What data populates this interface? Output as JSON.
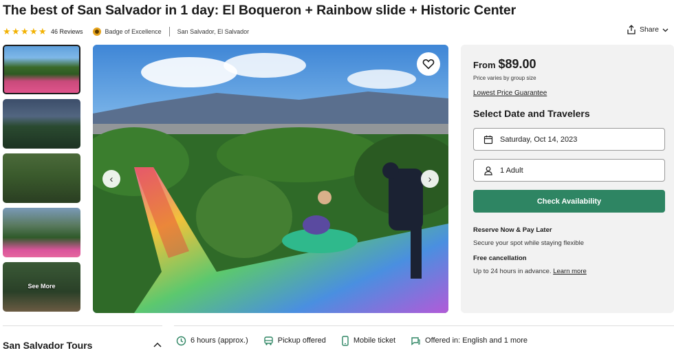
{
  "title": "The best of San Salvador in 1 day: El Boqueron + Rainbow slide + Historic Center",
  "meta": {
    "rating_stars": 5,
    "reviews": "46 Reviews",
    "badge": "Badge of Excellence",
    "location": "San Salvador, El Salvador",
    "share_label": "Share"
  },
  "gallery": {
    "see_more": "See More",
    "thumbnail_count": 5
  },
  "booking": {
    "from_label": "From",
    "price": "$89.00",
    "price_note": "Price varies by group size",
    "lowest_price": "Lowest Price Guarantee",
    "select_title": "Select Date and Travelers",
    "date_value": "Saturday, Oct 14, 2023",
    "travelers_value": "1 Adult",
    "check_button": "Check Availability",
    "reserve_title": "Reserve Now & Pay Later",
    "reserve_text": "Secure your spot while staying flexible",
    "cancel_title": "Free cancellation",
    "cancel_text": "Up to 24 hours in advance.",
    "learn_more": "Learn more",
    "accent_color": "#2e8563"
  },
  "bottom": {
    "tours_title": "San Salvador Tours",
    "features": [
      {
        "icon": "clock-icon",
        "label": "6 hours (approx.)"
      },
      {
        "icon": "bus-icon",
        "label": "Pickup offered"
      },
      {
        "icon": "phone-icon",
        "label": "Mobile ticket"
      },
      {
        "icon": "chat-icon",
        "label": "Offered in: English and 1 more"
      }
    ]
  }
}
